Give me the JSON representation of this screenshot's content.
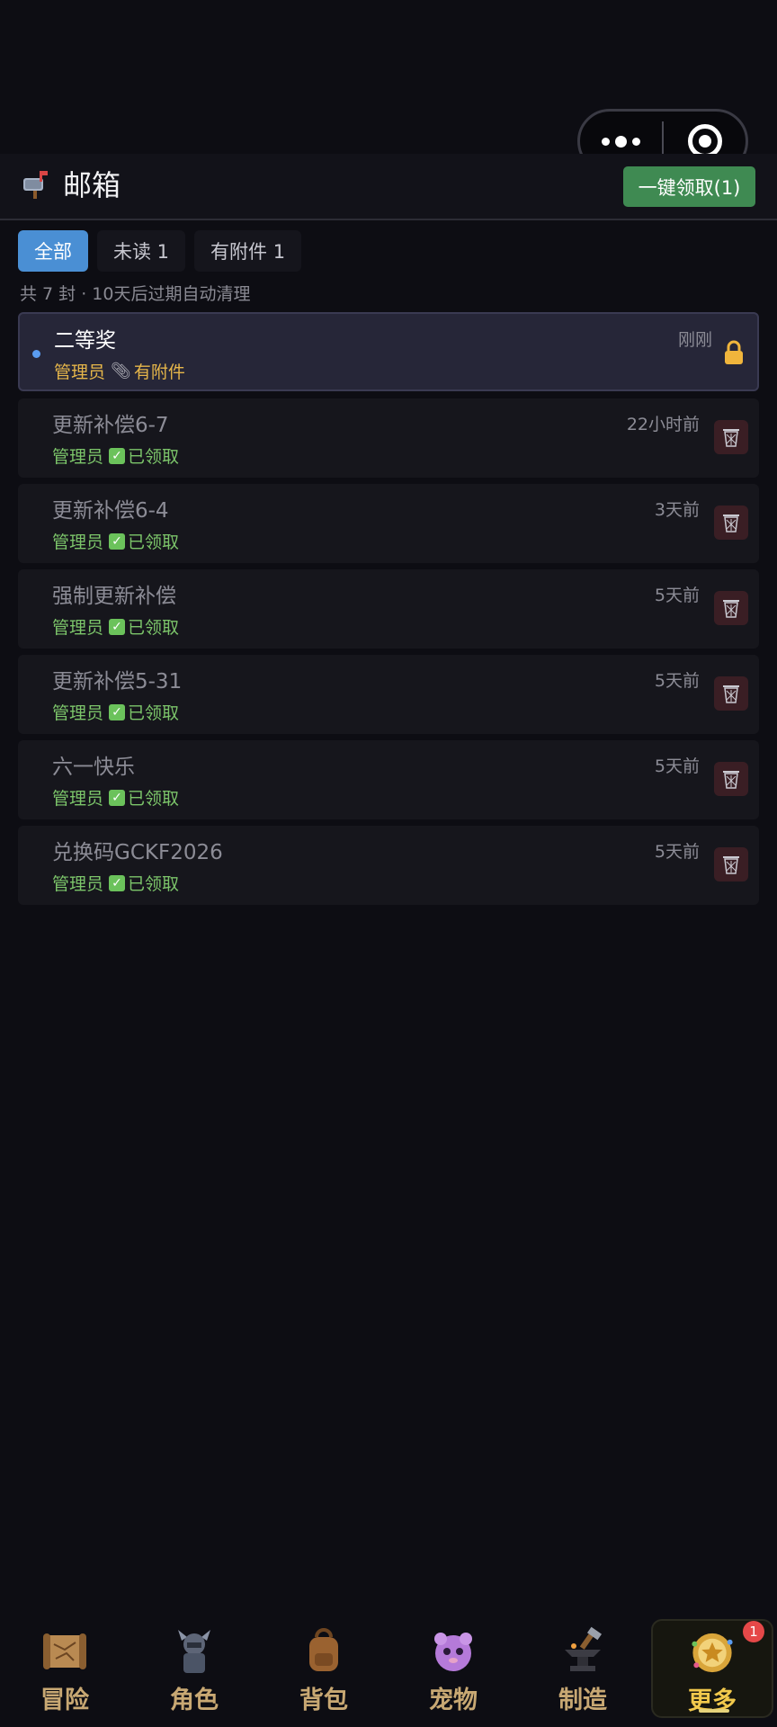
{
  "header": {
    "title": "邮箱",
    "icon": "mailbox-icon",
    "claim_all_label": "一键领取(1)"
  },
  "tabs": [
    {
      "label": "全部",
      "active": true
    },
    {
      "label": "未读 1",
      "active": false
    },
    {
      "label": "有附件 1",
      "active": false
    }
  ],
  "summary": "共 7 封 · 10天后过期自动清理",
  "mails": [
    {
      "subject": "二等奖",
      "sender": "管理员",
      "status": "有附件",
      "time": "刚刚",
      "unread": true
    },
    {
      "subject": "更新补偿6-7",
      "sender": "管理员",
      "status": "已领取",
      "time": "22小时前",
      "unread": false
    },
    {
      "subject": "更新补偿6-4",
      "sender": "管理员",
      "status": "已领取",
      "time": "3天前",
      "unread": false
    },
    {
      "subject": "强制更新补偿",
      "sender": "管理员",
      "status": "已领取",
      "time": "5天前",
      "unread": false
    },
    {
      "subject": "更新补偿5-31",
      "sender": "管理员",
      "status": "已领取",
      "time": "5天前",
      "unread": false
    },
    {
      "subject": "六一快乐",
      "sender": "管理员",
      "status": "已领取",
      "time": "5天前",
      "unread": false
    },
    {
      "subject": "兑换码GCKF2026",
      "sender": "管理员",
      "status": "已领取",
      "time": "5天前",
      "unread": false
    }
  ],
  "nav": [
    {
      "label": "冒险",
      "icon": "map-scroll-icon"
    },
    {
      "label": "角色",
      "icon": "knight-icon"
    },
    {
      "label": "背包",
      "icon": "backpack-icon"
    },
    {
      "label": "宠物",
      "icon": "pet-icon"
    },
    {
      "label": "制造",
      "icon": "anvil-icon"
    },
    {
      "label": "更多",
      "icon": "more-medal-icon",
      "active": true,
      "badge": "1"
    }
  ],
  "colors": {
    "background": "#0d0d13",
    "accent_blue": "#4a8fd4",
    "claim_green": "#3f8a52",
    "sender_green": "#7cc56a",
    "gold": "#e6b64a",
    "nav_label": "#c8a873"
  }
}
